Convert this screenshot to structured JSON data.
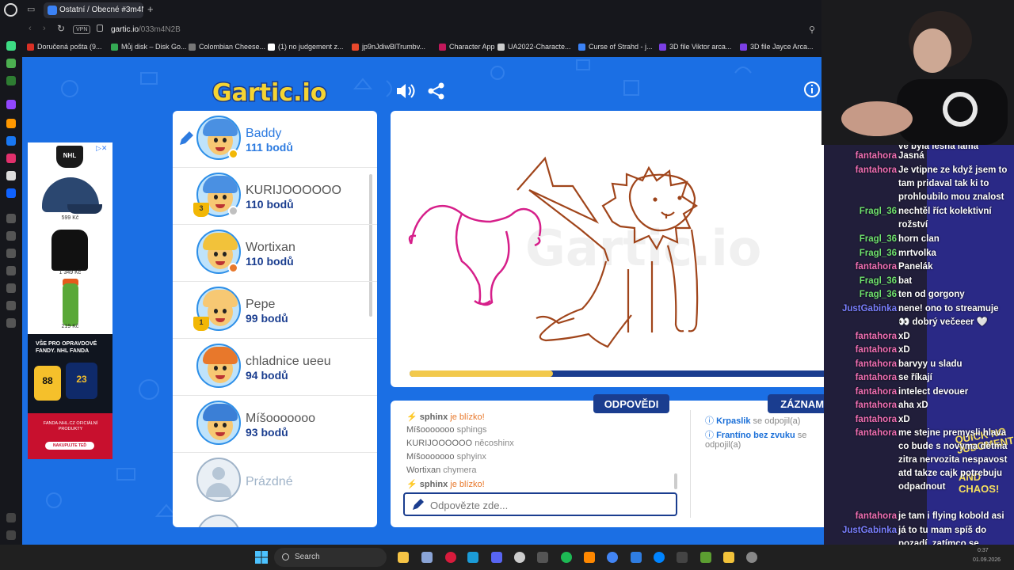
{
  "browser": {
    "tab_title": "Ostatní / Obecné #3m4N2B",
    "new_tab_symbol": "+",
    "vpn_label": "VPN",
    "url_host": "gartic.io",
    "url_path": "/033m4N2B",
    "bookmarks": [
      {
        "label": "Doručená pošta (9...",
        "color": "#d93025"
      },
      {
        "label": "Můj disk – Disk Go...",
        "color": "#34a853"
      },
      {
        "label": "Colombian Cheese...",
        "color": "#777777"
      },
      {
        "label": "(1) no judgement z...",
        "color": "#ffffff"
      },
      {
        "label": "jp9nJdiwBlTrumbv...",
        "color": "#e8482c"
      },
      {
        "label": "Character App",
        "color": "#c2185b"
      },
      {
        "label": "UA2022-Characte...",
        "color": "#cccccc"
      },
      {
        "label": "Curse of Strahd - j...",
        "color": "#3b82f6"
      },
      {
        "label": "3D file Viktor arca...",
        "color": "#7b3fe4"
      },
      {
        "label": "3D file Jayce Arca...",
        "color": "#7b3fe4"
      }
    ]
  },
  "game": {
    "logo_text": "Gartic.io",
    "players": [
      {
        "name": "Baddy",
        "points": "111 bodů",
        "drawing": true,
        "hair": "#4a90e2",
        "skin": "#f7c873",
        "dot": "#f2b705",
        "trophy": ""
      },
      {
        "name": "KURIJOOOOOO",
        "points": "110 bodů",
        "drawing": false,
        "hair": "#4a90e2",
        "skin": "#f7c873",
        "dot": "#c0c0c0",
        "trophy": "3"
      },
      {
        "name": "Wortixan",
        "points": "110 bodů",
        "drawing": false,
        "hair": "#f2c23a",
        "skin": "#f7c873",
        "dot": "#e8782b",
        "trophy": ""
      },
      {
        "name": "Pepe",
        "points": "99 bodů",
        "drawing": false,
        "hair": "#f7c873",
        "skin": "#f7c873",
        "dot": "",
        "trophy": "1"
      },
      {
        "name": "chladnice ueeu",
        "points": "94 bodů",
        "drawing": false,
        "hair": "#e8782b",
        "skin": "#f7c873",
        "dot": "",
        "trophy": ""
      },
      {
        "name": "Míšooooooo",
        "points": "93 bodů",
        "drawing": false,
        "hair": "#3b7fd6",
        "skin": "#f7c873",
        "dot": "",
        "trophy": ""
      }
    ],
    "empty_slot": "Prázdné",
    "timer_progress": 0.33,
    "tab_answers": "ODPOVĚDI",
    "tab_records": "ZÁZNAMY",
    "answers": [
      {
        "type": "close",
        "who": "sphinx",
        "text": "je blízko!"
      },
      {
        "type": "guess",
        "who": "Míšooooooo",
        "text": "sphings"
      },
      {
        "type": "guess",
        "who": "KURIJOOOOOO",
        "text": "nĕcoshinx"
      },
      {
        "type": "guess",
        "who": "Míšooooooo",
        "text": "sphyinx"
      },
      {
        "type": "guess",
        "who": "Wortixan",
        "text": "chymera"
      },
      {
        "type": "close",
        "who": "sphinx",
        "text": "je blízko!"
      }
    ],
    "answer_placeholder": "Odpovězte zde...",
    "records": [
      {
        "name": "Krpaslik",
        "text": "se odpojil(a)"
      },
      {
        "name": "Frantíno bez zvuku",
        "text": "se odpojil(a)"
      }
    ],
    "ad": {
      "brand": "NHL",
      "prices": [
        "599 Kč",
        "1 349 Kč",
        "219 Kč"
      ],
      "banner_title": "VŠE PRO OPRAVDOVÉ FANDY. NHL FANDA",
      "jersey1": "88",
      "jersey2": "23",
      "banner_sub": "FANDA-NHL.CZ OFICIÁLNÍ PRODUKTY",
      "cta": "NAKUPUJTE TEĎ"
    }
  },
  "chat": {
    "top_partial": "ve byla lesna lama",
    "banner1": "QUICK NO JUDGMENT",
    "banner2": "AND CHAOS!",
    "messages": [
      {
        "user": "fantahora",
        "color": "#f06fb4",
        "text": "Jasná",
        "lines": 1
      },
      {
        "user": "fantahora",
        "color": "#f06fb4",
        "text": "Je vtipne ze když jsem to tam pridaval tak ki to prohloubilo mou znalost",
        "lines": 3
      },
      {
        "user": "Fragl_36",
        "color": "#6fe06f",
        "text": "nechtěl říct kolektivní rožství",
        "lines": 2
      },
      {
        "user": "Fragl_36",
        "color": "#6fe06f",
        "text": "horn clan",
        "lines": 1
      },
      {
        "user": "Fragl_36",
        "color": "#6fe06f",
        "text": "mrtvolka",
        "lines": 1
      },
      {
        "user": "fantahora",
        "color": "#f06fb4",
        "text": "Panelák",
        "lines": 1
      },
      {
        "user": "Fragl_36",
        "color": "#6fe06f",
        "text": "bat",
        "lines": 1
      },
      {
        "user": "Fragl_36",
        "color": "#6fe06f",
        "text": "ten od gorgony",
        "lines": 1
      },
      {
        "user": "JustGabinka",
        "color": "#7a7fff",
        "text": "nene! ono to streamuje 👀 dobrý večeeer 🤍",
        "lines": 2
      },
      {
        "user": "fantahora",
        "color": "#f06fb4",
        "text": "xD",
        "lines": 1
      },
      {
        "user": "fantahora",
        "color": "#f06fb4",
        "text": "xD",
        "lines": 1
      },
      {
        "user": "fantahora",
        "color": "#f06fb4",
        "text": "barvyy u sladu",
        "lines": 1
      },
      {
        "user": "fantahora",
        "color": "#f06fb4",
        "text": "se říkají",
        "lines": 1
      },
      {
        "user": "fantahora",
        "color": "#f06fb4",
        "text": "intelect devouer",
        "lines": 1
      },
      {
        "user": "fantahora",
        "color": "#f06fb4",
        "text": "aha xD",
        "lines": 1
      },
      {
        "user": "fantahora",
        "color": "#f06fb4",
        "text": "xD",
        "lines": 1
      },
      {
        "user": "fantahora",
        "color": "#f06fb4",
        "text": "me stejne premysli hlava co bude s novyma dětma zitra nervozita nespavost atd takze cajk potrebuju odpadnout",
        "lines": 6
      },
      {
        "user": "fantahora",
        "color": "#f06fb4",
        "text": "je tam i flying kobold asi",
        "lines": 1
      },
      {
        "user": "JustGabinka",
        "color": "#7a7fff",
        "text": "já to tu mam spíš do pozadí, zatímco se snažím uběhat kočku ke spánku xD",
        "lines": 4
      }
    ]
  },
  "taskbar": {
    "search_label": "Search",
    "date": "01.09.2026",
    "time": "0:37"
  }
}
